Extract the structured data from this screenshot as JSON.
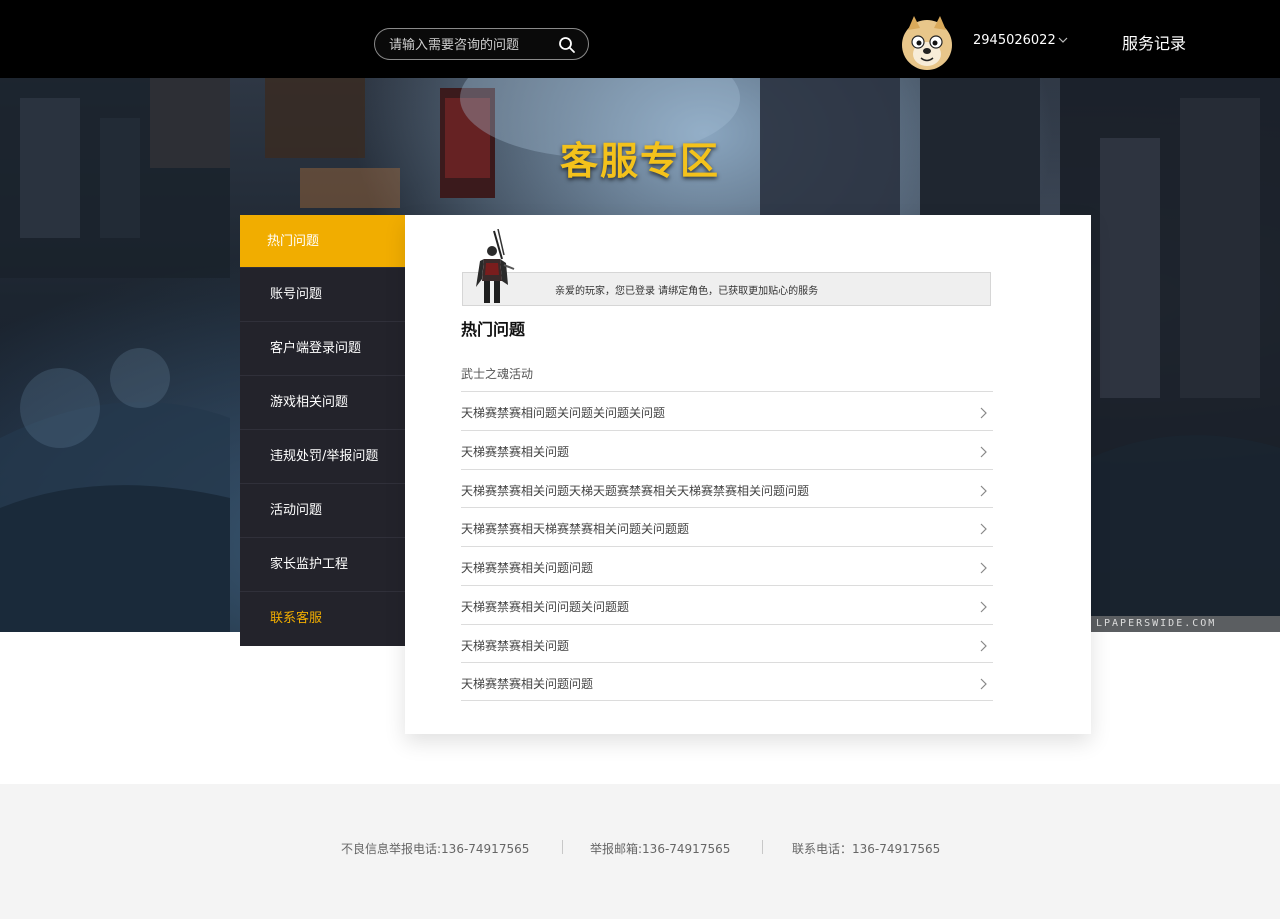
{
  "header": {
    "search_placeholder": "请输入需要咨询的问题",
    "user_id": "2945026022",
    "service_record": "服务记录"
  },
  "banner": {
    "title": "客服专区",
    "watermark": "LPAPERSWIDE.COM"
  },
  "sidebar": {
    "items": [
      {
        "label": "热门问题"
      },
      {
        "label": "账号问题"
      },
      {
        "label": "客户端登录问题"
      },
      {
        "label": "游戏相关问题"
      },
      {
        "label": "违规处罚/举报问题"
      },
      {
        "label": "活动问题"
      },
      {
        "label": "家长监护工程"
      },
      {
        "label": "联系客服"
      }
    ]
  },
  "main": {
    "notice": "亲爱的玩家，您已登录 请绑定角色，已获取更加贴心的服务",
    "section_title": "热门问题",
    "first_item": "武士之魂活动",
    "questions": [
      "天梯赛禁赛相问题关问题关问题关问题",
      "天梯赛禁赛相关问题",
      "天梯赛禁赛相关问题天梯天题赛禁赛相关天梯赛禁赛相关问题问题",
      "天梯赛禁赛相天梯赛禁赛相关问题关问题题",
      "天梯赛禁赛相关问题问题",
      "天梯赛禁赛相关问问题关问题题",
      "天梯赛禁赛相关问题",
      "天梯赛禁赛相关问题问题"
    ]
  },
  "footer": {
    "report_phone": "不良信息举报电话:136-74917565",
    "report_email": "举报邮箱:136-74917565",
    "contact_phone": "联系电话：136-74917565"
  },
  "colors": {
    "accent": "#f1ad00",
    "sidebar_bg": "#23232b",
    "header_bg": "#000000"
  },
  "icons": {
    "search": "search-icon",
    "dropdown": "chevron-down-icon",
    "row_arrow": "chevron-right-icon",
    "avatar": "dog-avatar-icon"
  }
}
